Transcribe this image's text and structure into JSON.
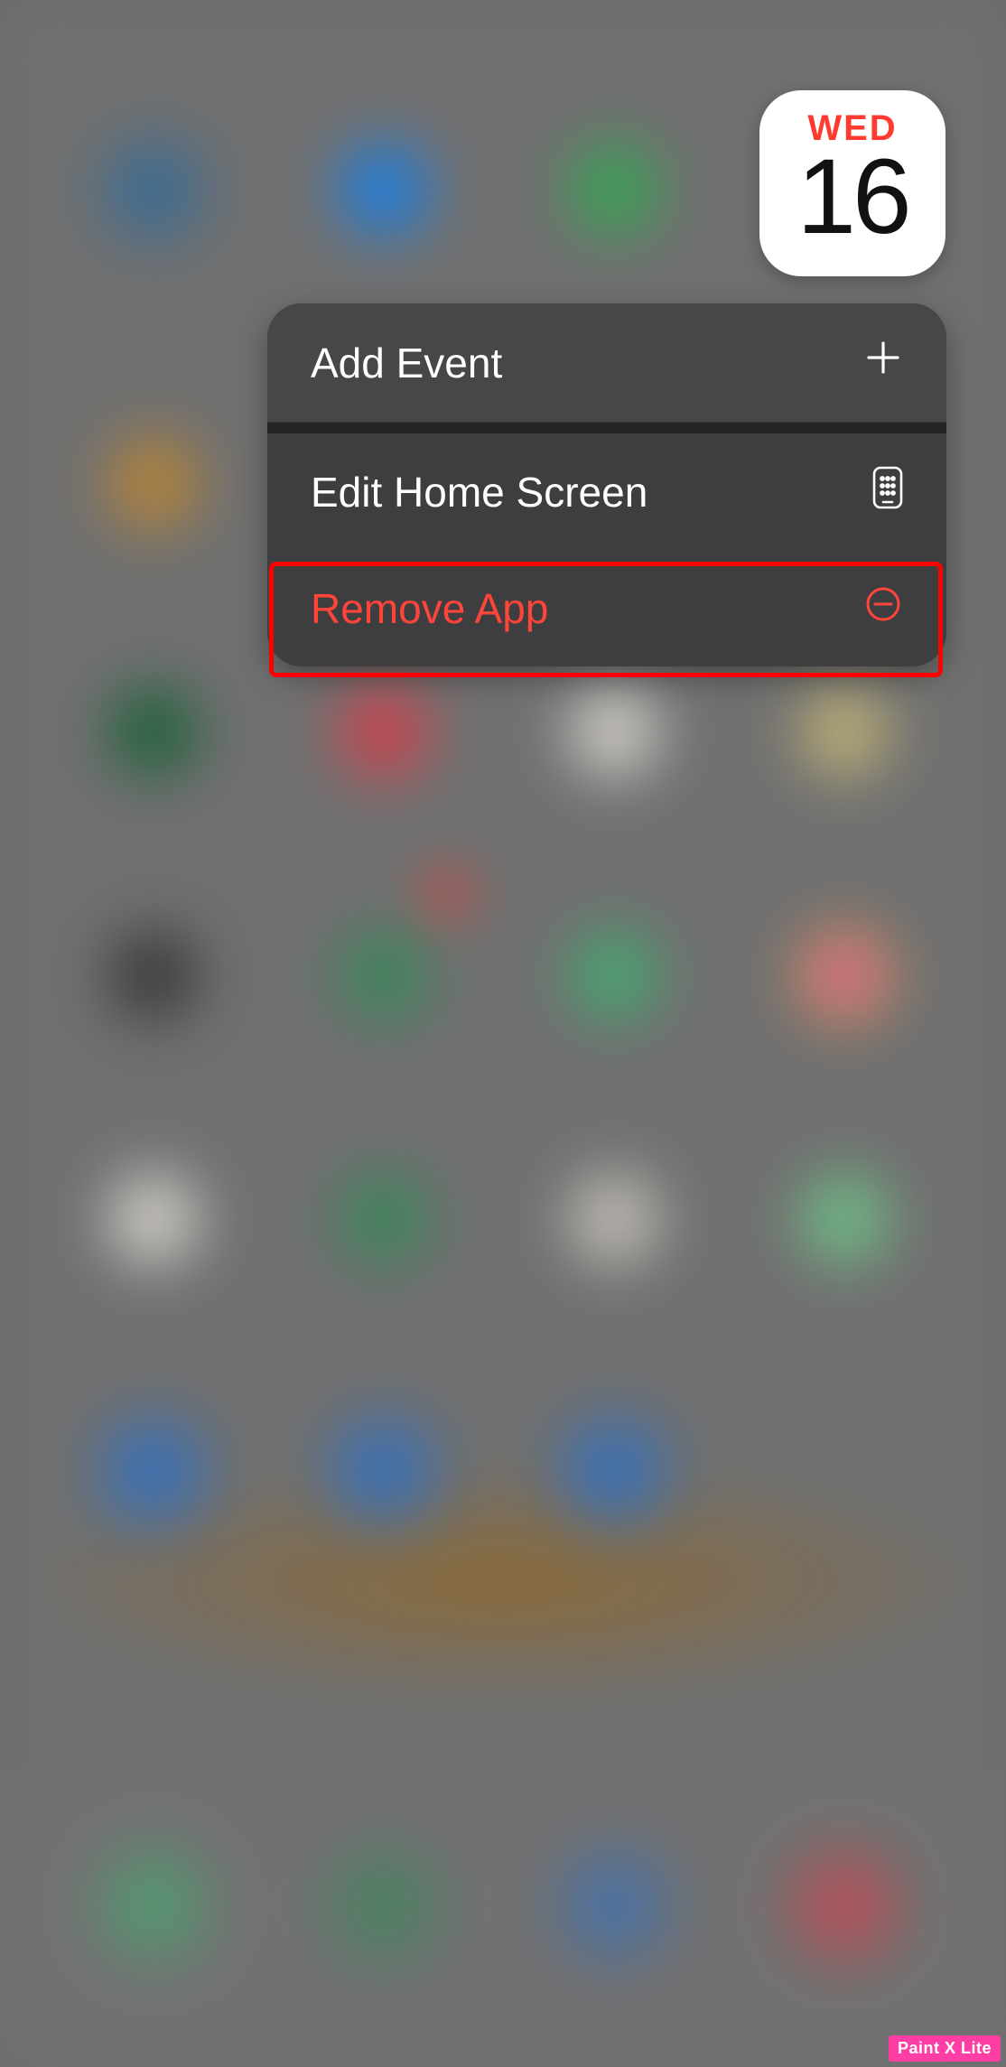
{
  "calendar": {
    "day_name": "WED",
    "day_number": "16"
  },
  "menu": {
    "add_event_label": "Add Event",
    "edit_home_label": "Edit Home Screen",
    "remove_app_label": "Remove App"
  },
  "watermark": {
    "text": "Paint X Lite"
  },
  "colors": {
    "destructive": "#ff453a",
    "highlight": "#ff0000",
    "calendar_red": "#ff3b30"
  }
}
